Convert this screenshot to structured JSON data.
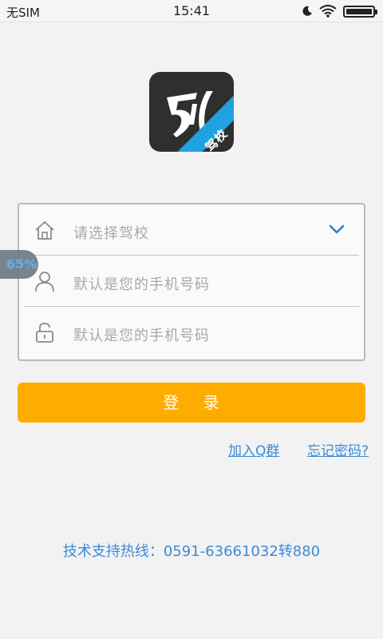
{
  "status_bar": {
    "carrier": "无SIM",
    "time": "15:41"
  },
  "logo": {
    "badge_text": "驾校",
    "accent_color": "#1fa2e0"
  },
  "form": {
    "school_select": {
      "placeholder": "请选择驾校"
    },
    "username": {
      "placeholder": "默认是您的手机号码"
    },
    "password": {
      "placeholder": "默认是您的手机号码"
    }
  },
  "floating_badge": {
    "text": "65%"
  },
  "login_button": {
    "label": "登    录",
    "color": "#ffac00"
  },
  "links": {
    "join_group": "加入Q群",
    "forgot_password": "忘记密码?"
  },
  "hotline": "技术支持热线：0591-63661032转880",
  "colors": {
    "link": "#3b8bd6",
    "background": "#f2f2f2"
  }
}
